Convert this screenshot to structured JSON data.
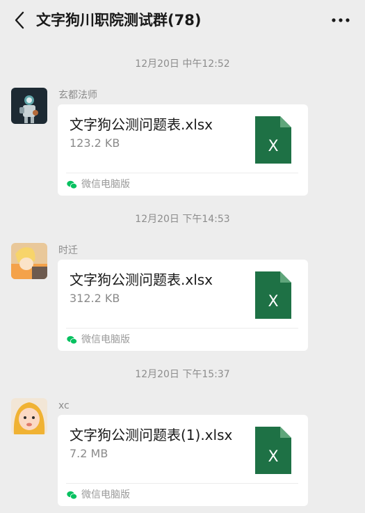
{
  "header": {
    "title": "文字狗川职院测试群(78)",
    "back_icon": "chevron-left-icon",
    "more_icon": "more-dots-icon"
  },
  "messages": [
    {
      "time": "12月20日 中午12:52",
      "sender": "玄都法师",
      "avatar": "astronaut-avatar",
      "file": {
        "name": "文字狗公测问题表.xlsx",
        "size": "123.2 KB",
        "type": "excel-file-icon",
        "badge": "X"
      },
      "source": "微信电脑版"
    },
    {
      "time": "12月20日 下午14:53",
      "sender": "时迁",
      "avatar": "anime-avatar",
      "file": {
        "name": "文字狗公测问题表.xlsx",
        "size": "312.2 KB",
        "type": "excel-file-icon",
        "badge": "X"
      },
      "source": "微信电脑版"
    },
    {
      "time": "12月20日 下午15:37",
      "sender": "xc",
      "avatar": "child-avatar",
      "file": {
        "name": "文字狗公测问题表(1).xlsx",
        "size": "7.2 MB",
        "type": "excel-file-icon",
        "badge": "X"
      },
      "source": "微信电脑版"
    }
  ],
  "colors": {
    "background": "#ededed",
    "card": "#ffffff",
    "excel_green": "#1e7145",
    "wechat_green": "#07c160",
    "meta_text": "#8c8c8c"
  }
}
